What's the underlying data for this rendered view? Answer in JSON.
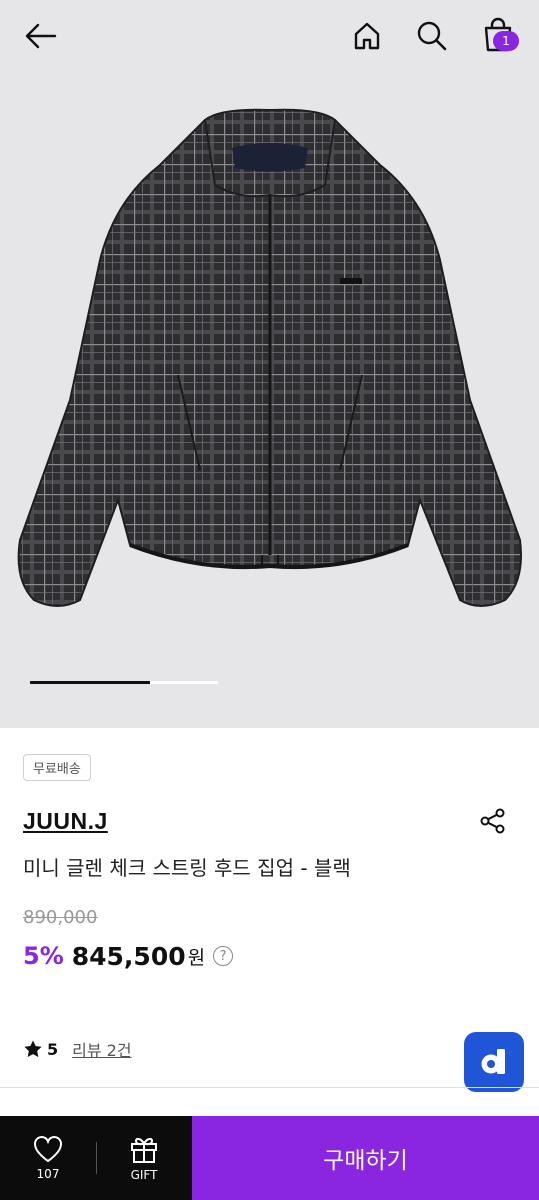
{
  "header": {
    "back_icon": "back-arrow-icon",
    "home_icon": "home-icon",
    "search_icon": "search-icon",
    "cart_icon": "shopping-bag-icon",
    "cart_count": "1"
  },
  "gallery": {
    "image": "plaid-hooded-jacket",
    "progress": 0.64
  },
  "product": {
    "badge": "무료배송",
    "brand": "JUUN.J",
    "title": "미니 글렌 체크 스트링 후드 집업 - 블랙",
    "original_price": "890,000",
    "discount": "5%",
    "price": "845,500",
    "currency": "원",
    "help_symbol": "?",
    "rating": "5",
    "review_link": "리뷰 2건"
  },
  "fab": {
    "label": "d"
  },
  "bottom_bar": {
    "like_count": "107",
    "gift_label": "GIFT",
    "buy_label": "구매하기"
  },
  "colors": {
    "accent": "#8a26e0",
    "fab": "#1f55d6",
    "hero_bg": "#e6e6e8"
  }
}
